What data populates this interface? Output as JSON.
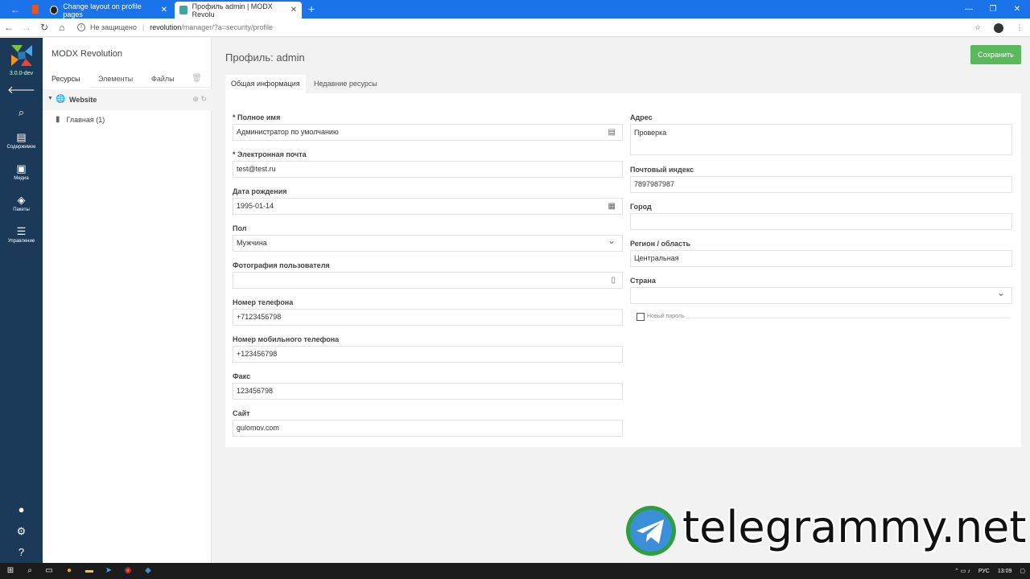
{
  "browser": {
    "tabs": [
      {
        "label": "Change layout on profile pages",
        "active": false
      },
      {
        "label": "Профиль admin | MODX Revolu",
        "active": true
      }
    ],
    "security_label": "Не защищено",
    "url_host": "revolution",
    "url_path": "/manager/?a=security/profile"
  },
  "rail": {
    "version": "3.0.0-dev",
    "items": [
      {
        "label": "",
        "icon": "arrow-left-icon"
      },
      {
        "label": "",
        "icon": "search-icon"
      },
      {
        "label": "Содержимое",
        "icon": "document-icon"
      },
      {
        "label": "Медиа",
        "icon": "media-icon"
      },
      {
        "label": "Пакеты",
        "icon": "package-icon"
      },
      {
        "label": "Управление",
        "icon": "sliders-icon"
      }
    ]
  },
  "tree": {
    "brand": "MODX Revolution",
    "tabs": [
      "Ресурсы",
      "Элементы",
      "Файлы"
    ],
    "context": "Website",
    "node": "Главная (1)"
  },
  "page": {
    "title": "Профиль: admin",
    "save_label": "Сохранить",
    "tabs": [
      "Общая информация",
      "Недавние ресурсы"
    ]
  },
  "form": {
    "left": [
      {
        "label": "* Полное имя",
        "value": "Администратор по умолчанию",
        "trail": "▤"
      },
      {
        "label": "* Электронная почта",
        "value": "test@test.ru",
        "trail": ""
      },
      {
        "label": "Дата рождения",
        "value": "1995-01-14",
        "trail": "▦"
      },
      {
        "label": "Пол",
        "value": "Мужчина",
        "trail": "⌄"
      },
      {
        "label": "Фотография пользователя",
        "value": "",
        "trail": "▯"
      },
      {
        "label": "Номер телефона",
        "value": "+7123456798",
        "trail": ""
      },
      {
        "label": "Номер мобильного телефона",
        "value": "+123456798",
        "trail": ""
      },
      {
        "label": "Факс",
        "value": "123456798",
        "trail": ""
      },
      {
        "label": "Сайт",
        "value": "gulomov.com",
        "trail": ""
      }
    ],
    "right": [
      {
        "label": "Адрес",
        "value": "Проверка"
      },
      {
        "label": "Почтовый индекс",
        "value": "7897987987"
      },
      {
        "label": "Город",
        "value": ""
      },
      {
        "label": "Регион / область",
        "value": "Центральная"
      },
      {
        "label": "Страна",
        "value": ""
      }
    ],
    "new_password_label": "Новый пароль"
  },
  "watermark": "telegrammy.net",
  "taskbar": {
    "lang": "РУС",
    "time": "13:09"
  }
}
